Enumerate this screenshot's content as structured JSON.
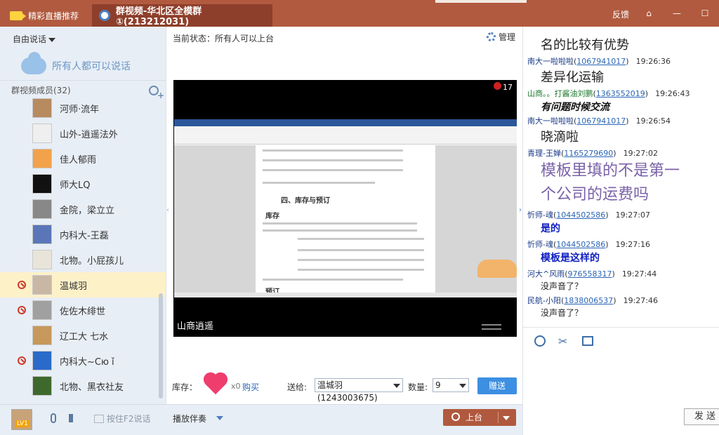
{
  "topbar": {
    "live_tab": "精彩直播推荐",
    "group_tab": "群视频-华北区全模群①(213212031)",
    "feedback": "反馈"
  },
  "left": {
    "free_talk": "自由说话",
    "all_can_speak": "所有人都可以说话",
    "members_header": "群视频成员(32)",
    "members": [
      {
        "name": "河师·流年",
        "banned": false
      },
      {
        "name": "山外-逍遥法外",
        "banned": false
      },
      {
        "name": "佳人郁雨",
        "banned": false
      },
      {
        "name": "师大LQ",
        "banned": false
      },
      {
        "name": "金院，梁立立",
        "banned": false
      },
      {
        "name": "内科大-王磊",
        "banned": false
      },
      {
        "name": "北物。小屁孩儿",
        "banned": false
      },
      {
        "name": "温城羽",
        "banned": true,
        "selected": true
      },
      {
        "name": "佐佐木绯世",
        "banned": true
      },
      {
        "name": "辽工大 七水",
        "banned": false
      },
      {
        "name": "内科大~Cю ǐ",
        "banned": true
      },
      {
        "name": "北物、黑衣社友",
        "banned": false
      }
    ],
    "level": "LV1",
    "push_to_talk": "按住F2说话"
  },
  "middle": {
    "status": "当前状态：所有人可以上台",
    "manage": "管理",
    "rose_count": "17",
    "doc_title": "四、库存与预订",
    "doc_sub1": "库存",
    "doc_sub2": "预订",
    "caption": "山商逍遥",
    "inventory_label": "库存：",
    "gift_count": "x0",
    "buy": "购买",
    "send_to_label": "送给:",
    "send_to_value": "温城羽(1243003675)",
    "qty_label": "数量:",
    "qty_value": "9",
    "give_button": "赠送",
    "accompany": "播放伴奏",
    "stage_button": "上台"
  },
  "chat": {
    "messages": [
      {
        "body": "名的比较有优势",
        "body_style": "big"
      },
      {
        "sender": "南大一啦啦啦",
        "qq": "1067941017",
        "time": "19:26:36",
        "body": "差异化运输",
        "body_style": "big"
      },
      {
        "sender": "山商。。打酱油刘鹏",
        "qq": "1363552019",
        "time": "19:26:43",
        "body": "有问题时候交流",
        "body_style": "italic"
      },
      {
        "sender": "南大一啦啦啦",
        "qq": "1067941017",
        "time": "19:26:54",
        "body": "晓滴啦",
        "body_style": "big"
      },
      {
        "sender": "青理-王婵",
        "qq": "1165279690",
        "time": "19:27:02",
        "body": "模板里填的不是第一",
        "body2": "个公司的运费吗",
        "body_style": "purple"
      },
      {
        "sender": "忻师-魂",
        "qq": "1044502586",
        "time": "19:27:07",
        "body": "是的",
        "body_style": "blue"
      },
      {
        "sender": "忻师-魂",
        "qq": "1044502586",
        "time": "19:27:16",
        "body": "模板是这样的",
        "body_style": "blue"
      },
      {
        "sender": "河大^风雨",
        "qq": "976558317",
        "time": "19:27:44",
        "body": "没声音了？",
        "body_style": "small"
      },
      {
        "sender": "民航-小阳",
        "qq": "1838006537",
        "time": "19:27:46",
        "body": "没声音了？",
        "body_style": "small"
      }
    ],
    "send_button": "发 送"
  },
  "colors": {
    "topbar": "#b15a3f",
    "accent_blue": "#3d8fe2",
    "sidebar": "#e8eef5"
  }
}
